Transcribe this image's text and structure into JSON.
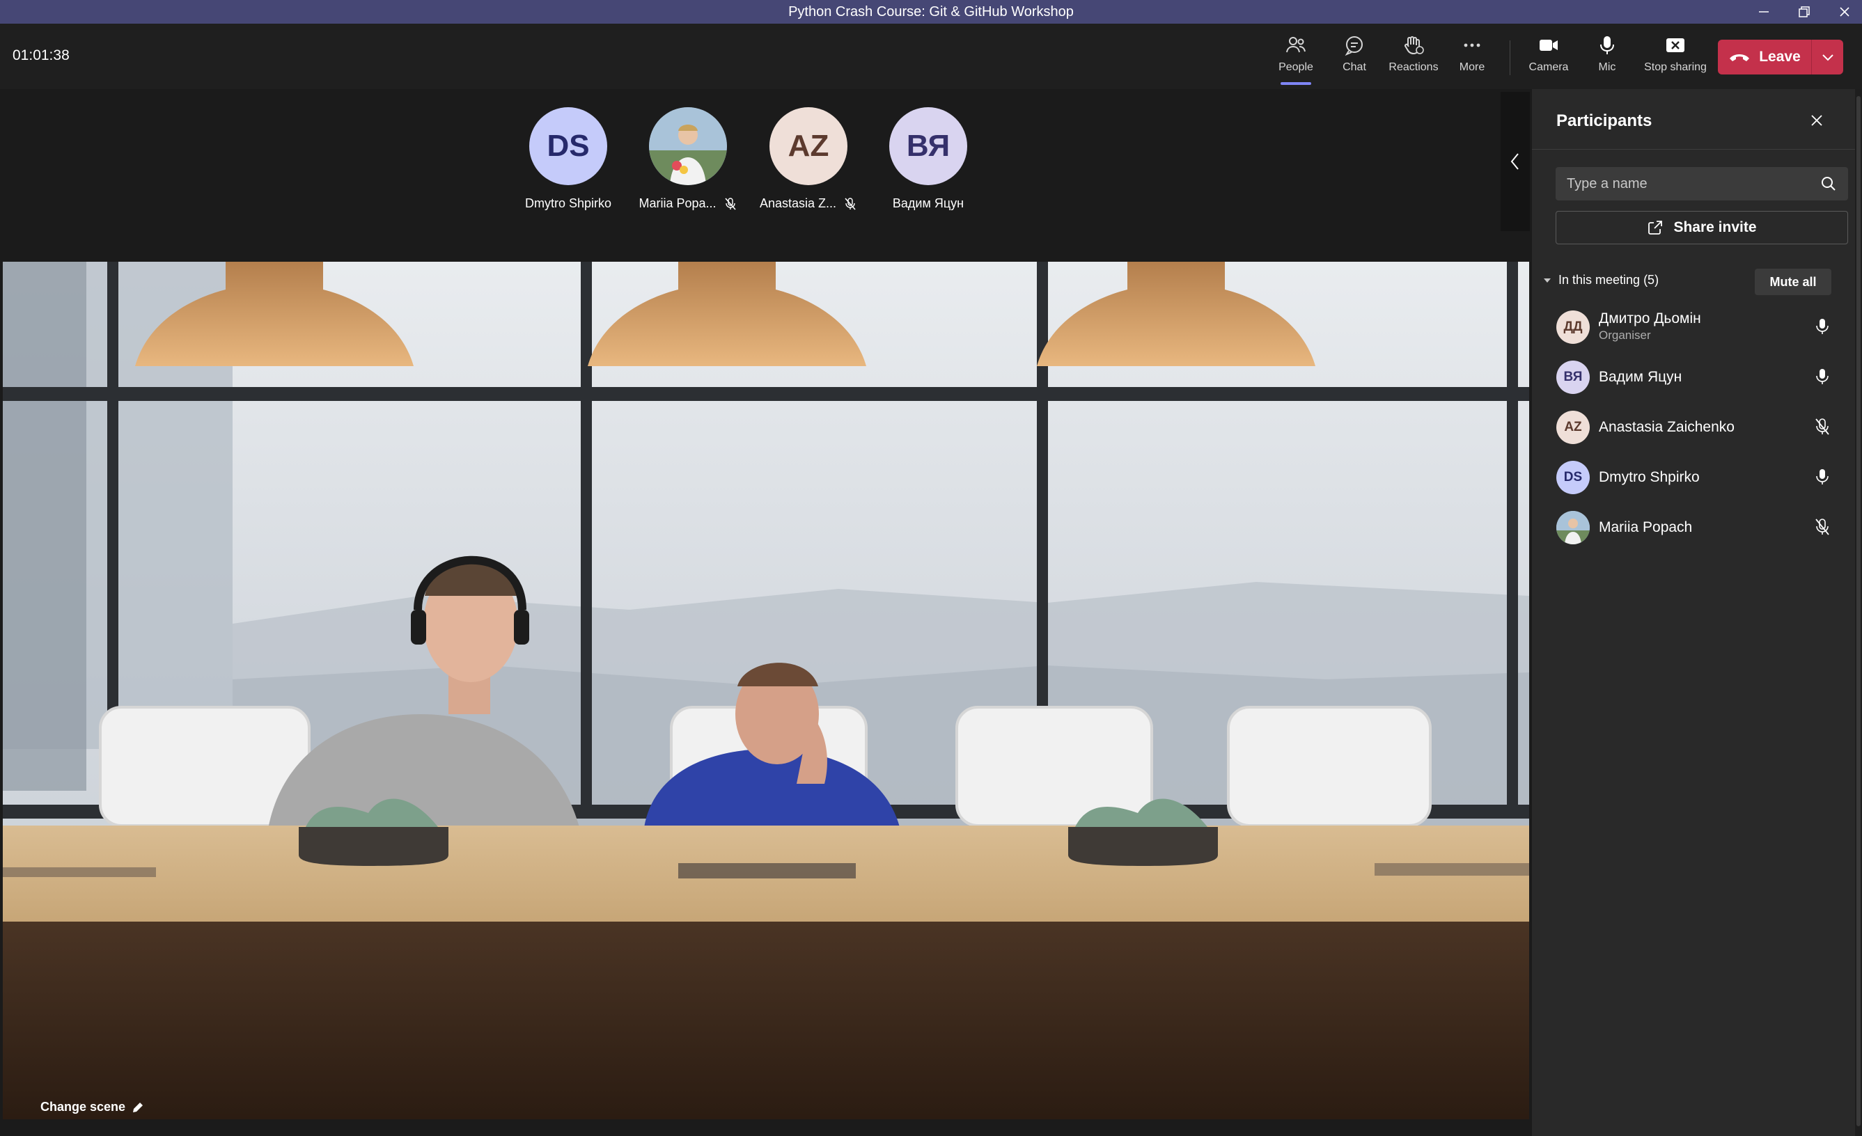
{
  "window": {
    "title": "Python Crash Course: Git & GitHub Workshop"
  },
  "toolbar": {
    "timer": "01:01:38",
    "people": "People",
    "chat": "Chat",
    "reactions": "Reactions",
    "more": "More",
    "camera": "Camera",
    "mic": "Mic",
    "stop_sharing": "Stop sharing",
    "leave": "Leave"
  },
  "gallery": [
    {
      "initials": "DS",
      "name": "Dmytro Shpirko",
      "muted": false,
      "bg": "#c5cbfa",
      "fg": "#26296b"
    },
    {
      "initials": "",
      "name": "Mariia Popa...",
      "muted": true,
      "bg": "#9fb3c8",
      "fg": "#ffffff",
      "photo": true
    },
    {
      "initials": "AZ",
      "name": "Anastasia Z...",
      "muted": true,
      "bg": "#efdfd8",
      "fg": "#5c3a2e"
    },
    {
      "initials": "ВЯ",
      "name": "Вадим Яцун",
      "muted": false,
      "bg": "#d9d4f0",
      "fg": "#35306b"
    }
  ],
  "stage": {
    "change_scene": "Change scene"
  },
  "panel": {
    "title": "Participants",
    "search_placeholder": "Type a name",
    "share_invite": "Share invite",
    "section_label": "In this meeting (5)",
    "mute_all": "Mute all",
    "participants": [
      {
        "initials": "ДД",
        "name": "Дмитро Дьомін",
        "role": "Organiser",
        "muted": false,
        "bg": "#efdfd8",
        "fg": "#5c3a2e"
      },
      {
        "initials": "ВЯ",
        "name": "Вадим Яцун",
        "role": "",
        "muted": false,
        "bg": "#d9d4f0",
        "fg": "#35306b"
      },
      {
        "initials": "AZ",
        "name": "Anastasia Zaichenko",
        "role": "",
        "muted": true,
        "bg": "#efdfd8",
        "fg": "#5c3a2e"
      },
      {
        "initials": "DS",
        "name": "Dmytro Shpirko",
        "role": "",
        "muted": false,
        "bg": "#c5cbfa",
        "fg": "#26296b"
      },
      {
        "initials": "",
        "name": "Mariia Popach",
        "role": "",
        "muted": true,
        "bg": "#9fb3c8",
        "fg": "#ffffff",
        "photo": true
      }
    ]
  },
  "colors": {
    "titlebar": "#464775",
    "leave": "#c4314b",
    "accent": "#7f85f5"
  }
}
